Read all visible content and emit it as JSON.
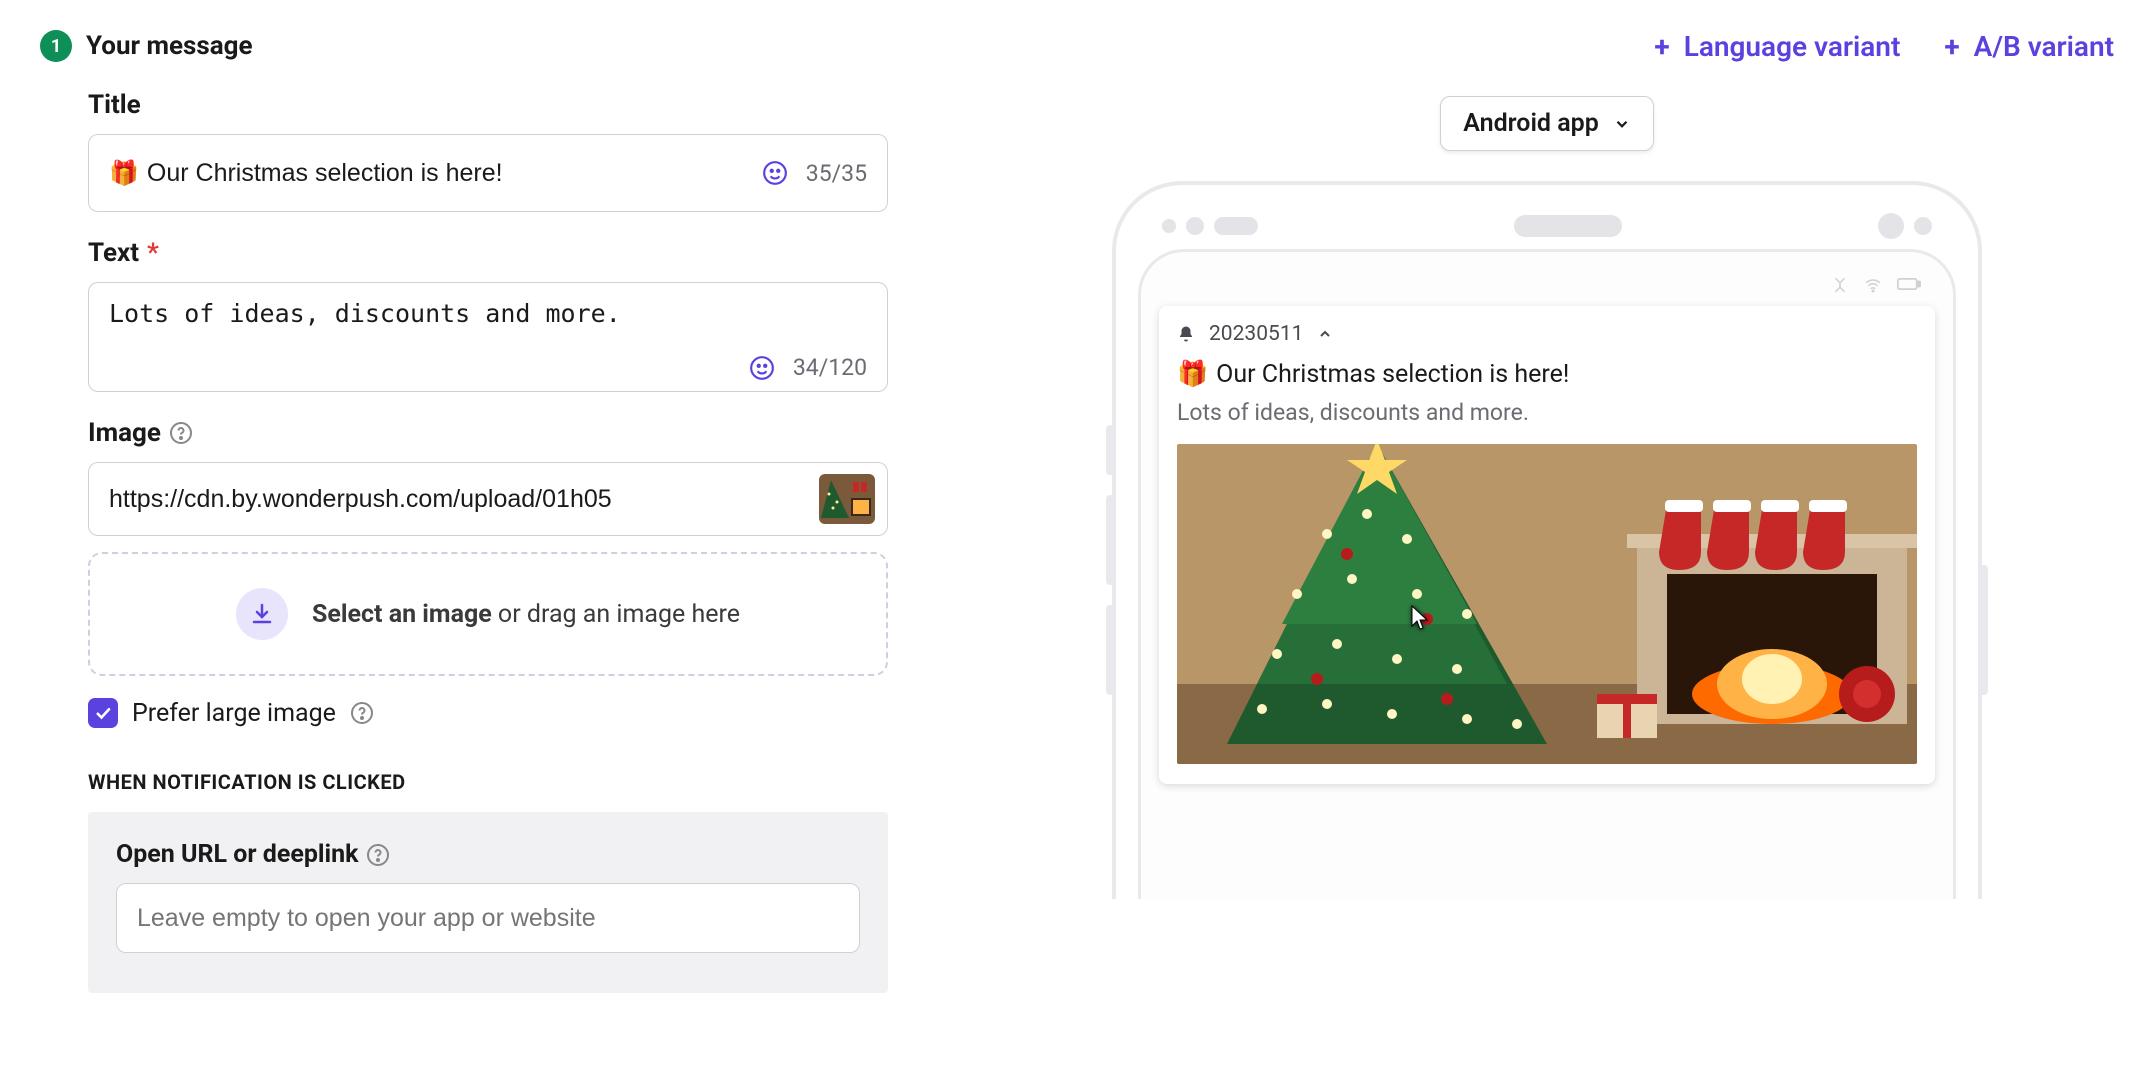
{
  "header": {
    "step_number": "1",
    "step_title": "Your message",
    "lang_variant": "Language variant",
    "ab_variant": "A/B variant"
  },
  "form": {
    "title_label": "Title",
    "title_value": "Our Christmas selection is here!",
    "title_count": "35/35",
    "text_label": "Text",
    "text_value": "Lots of ideas, discounts and more.",
    "text_count": "34/120",
    "image_label": "Image",
    "image_value": "https://cdn.by.wonderpush.com/upload/01h05",
    "dropzone_bold": "Select an image",
    "dropzone_rest": " or drag an image here",
    "prefer_large": "Prefer large image",
    "click_section": "WHEN NOTIFICATION IS CLICKED",
    "url_label": "Open URL or deeplink",
    "url_placeholder": "Leave empty to open your app or website"
  },
  "preview": {
    "device_select": "Android app",
    "notif_app": "20230511",
    "notif_title": "Our Christmas selection is here!",
    "notif_text": "Lots of ideas, discounts and more."
  }
}
